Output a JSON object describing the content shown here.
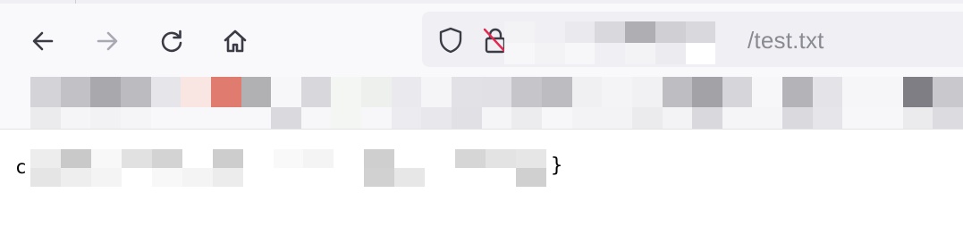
{
  "toolbar": {
    "back": {
      "icon": "arrow-left-icon",
      "enabled": true
    },
    "forward": {
      "icon": "arrow-right-icon",
      "enabled": false
    },
    "reload": {
      "icon": "reload-icon"
    },
    "home": {
      "icon": "home-icon"
    }
  },
  "urlbar": {
    "tracking_icon": "shield-icon",
    "security_icon": "insecure-lock-icon",
    "url_visible_suffix": "/test.txt"
  },
  "page": {
    "content_prefix": "c",
    "content_suffix": "}"
  },
  "colors": {
    "chrome_bg": "#f9f9fb",
    "urlbar_bg": "#f0f0f4",
    "icon_color": "#3b3b45",
    "disabled_icon_color": "#a9a9b3",
    "insecure_strike": "#e22850"
  }
}
